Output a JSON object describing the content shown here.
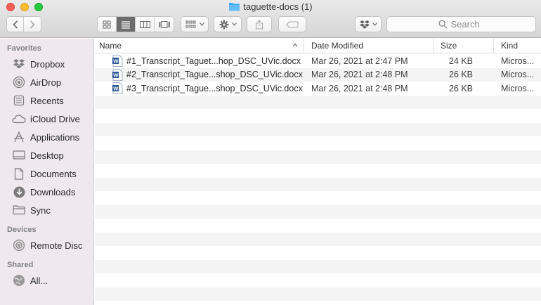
{
  "window": {
    "title": "taguette-docs (1)"
  },
  "toolbar": {
    "search_placeholder": "Search"
  },
  "sidebar": {
    "sections": [
      {
        "heading": "Favorites",
        "items": [
          {
            "label": "Dropbox",
            "icon": "dropbox-icon"
          },
          {
            "label": "AirDrop",
            "icon": "airdrop-icon"
          },
          {
            "label": "Recents",
            "icon": "recents-icon"
          },
          {
            "label": "iCloud Drive",
            "icon": "icloud-icon"
          },
          {
            "label": "Applications",
            "icon": "applications-icon"
          },
          {
            "label": "Desktop",
            "icon": "desktop-icon"
          },
          {
            "label": "Documents",
            "icon": "documents-icon"
          },
          {
            "label": "Downloads",
            "icon": "downloads-icon"
          },
          {
            "label": "Sync",
            "icon": "folder-icon"
          }
        ]
      },
      {
        "heading": "Devices",
        "items": [
          {
            "label": "Remote Disc",
            "icon": "disc-icon"
          }
        ]
      },
      {
        "heading": "Shared",
        "items": [
          {
            "label": "All...",
            "icon": "network-icon"
          }
        ]
      }
    ]
  },
  "list": {
    "columns": {
      "name": "Name",
      "date": "Date Modified",
      "size": "Size",
      "kind": "Kind"
    },
    "files": [
      {
        "name": "#1_Transcript_Taguet...hop_DSC_UVic.docx",
        "date": "Mar 26, 2021 at 2:47 PM",
        "size": "24 KB",
        "kind": "Micros..."
      },
      {
        "name": "#2_Transcript_Tague...shop_DSC_UVic.docx",
        "date": "Mar 26, 2021 at 2:48 PM",
        "size": "26 KB",
        "kind": "Micros..."
      },
      {
        "name": "#3_Transcript_Tague...shop_DSC_UVic.docx",
        "date": "Mar 26, 2021 at 2:48 PM",
        "size": "26 KB",
        "kind": "Micros..."
      }
    ]
  },
  "colors": {
    "accent": "#6d6d6d",
    "sidebar_bg": "#efe8ec",
    "word_blue": "#2b5797"
  }
}
